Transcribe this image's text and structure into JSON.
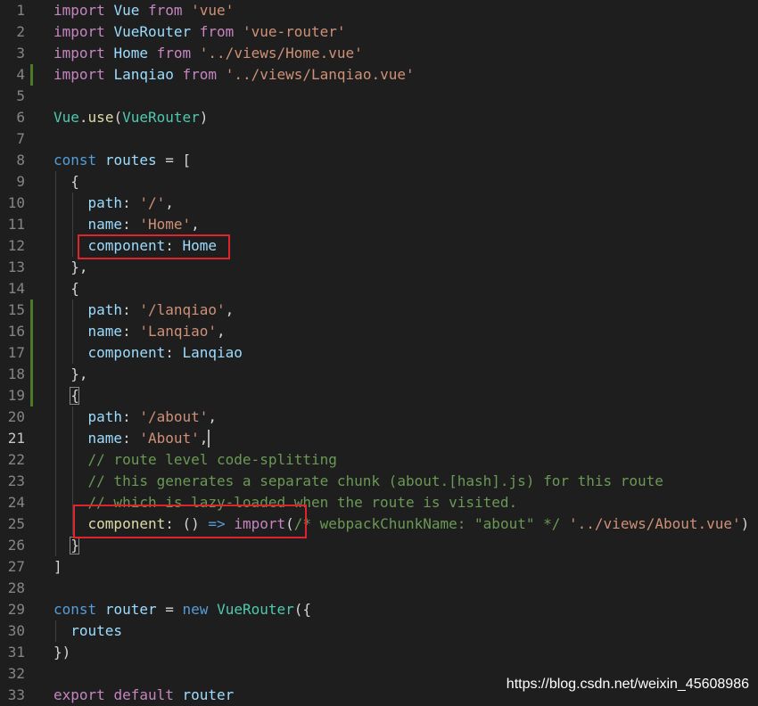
{
  "editor": {
    "active_line": 21,
    "colors": {
      "keyword": "#c586c0",
      "storage": "#569cd6",
      "variable": "#9cdcfe",
      "class": "#4ec9b0",
      "function": "#dcdcaa",
      "string": "#ce9178",
      "comment": "#6a9955",
      "punctuation": "#d4d4d4",
      "highlight_box": "#e0242d"
    },
    "lines": [
      {
        "n": "1",
        "tokens": [
          [
            "import",
            "keyword"
          ],
          [
            " "
          ],
          [
            "Vue",
            "variable"
          ],
          [
            " "
          ],
          [
            "from",
            "keyword"
          ],
          [
            " "
          ],
          [
            "'vue'",
            "string"
          ]
        ]
      },
      {
        "n": "2",
        "tokens": [
          [
            "import",
            "keyword"
          ],
          [
            " "
          ],
          [
            "VueRouter",
            "variable"
          ],
          [
            " "
          ],
          [
            "from",
            "keyword"
          ],
          [
            " "
          ],
          [
            "'vue-router'",
            "string"
          ]
        ]
      },
      {
        "n": "3",
        "tokens": [
          [
            "import",
            "keyword"
          ],
          [
            " "
          ],
          [
            "Home",
            "variable"
          ],
          [
            " "
          ],
          [
            "from",
            "keyword"
          ],
          [
            " "
          ],
          [
            "'../views/Home.vue'",
            "string"
          ]
        ]
      },
      {
        "n": "4",
        "tokens": [
          [
            "import",
            "keyword"
          ],
          [
            " "
          ],
          [
            "Lanqiao",
            "variable"
          ],
          [
            " "
          ],
          [
            "from",
            "keyword"
          ],
          [
            " "
          ],
          [
            "'../views/Lanqiao.vue'",
            "string"
          ]
        ]
      },
      {
        "n": "5",
        "tokens": []
      },
      {
        "n": "6",
        "tokens": [
          [
            "Vue",
            "class"
          ],
          [
            "."
          ],
          [
            "use",
            "function"
          ],
          [
            "("
          ],
          [
            "VueRouter",
            "class"
          ],
          [
            ")"
          ]
        ]
      },
      {
        "n": "7",
        "tokens": []
      },
      {
        "n": "8",
        "tokens": [
          [
            "const",
            "storage"
          ],
          [
            " "
          ],
          [
            "routes",
            "variable"
          ],
          [
            " = ["
          ]
        ]
      },
      {
        "n": "9",
        "tokens": [
          [
            "  {"
          ]
        ]
      },
      {
        "n": "10",
        "tokens": [
          [
            "    "
          ],
          [
            "path",
            "variable"
          ],
          [
            ": "
          ],
          [
            "'/'",
            "string"
          ],
          [
            ","
          ]
        ]
      },
      {
        "n": "11",
        "tokens": [
          [
            "    "
          ],
          [
            "name",
            "variable"
          ],
          [
            ": "
          ],
          [
            "'Home'",
            "string"
          ],
          [
            ","
          ]
        ]
      },
      {
        "n": "12",
        "tokens": [
          [
            "    "
          ],
          [
            "component",
            "variable"
          ],
          [
            ": "
          ],
          [
            "Home",
            "variable"
          ]
        ]
      },
      {
        "n": "13",
        "tokens": [
          [
            "  },"
          ]
        ]
      },
      {
        "n": "14",
        "tokens": [
          [
            "  {"
          ]
        ]
      },
      {
        "n": "15",
        "tokens": [
          [
            "    "
          ],
          [
            "path",
            "variable"
          ],
          [
            ": "
          ],
          [
            "'/lanqiao'",
            "string"
          ],
          [
            ","
          ]
        ]
      },
      {
        "n": "16",
        "tokens": [
          [
            "    "
          ],
          [
            "name",
            "variable"
          ],
          [
            ": "
          ],
          [
            "'Lanqiao'",
            "string"
          ],
          [
            ","
          ]
        ]
      },
      {
        "n": "17",
        "tokens": [
          [
            "    "
          ],
          [
            "component",
            "variable"
          ],
          [
            ": "
          ],
          [
            "Lanqiao",
            "variable"
          ]
        ]
      },
      {
        "n": "18",
        "tokens": [
          [
            "  },"
          ]
        ]
      },
      {
        "n": "19",
        "tokens": [
          [
            "  {"
          ]
        ]
      },
      {
        "n": "20",
        "tokens": [
          [
            "    "
          ],
          [
            "path",
            "variable"
          ],
          [
            ": "
          ],
          [
            "'/about'",
            "string"
          ],
          [
            ","
          ]
        ]
      },
      {
        "n": "21",
        "tokens": [
          [
            "    "
          ],
          [
            "name",
            "variable"
          ],
          [
            ": "
          ],
          [
            "'About'",
            "string"
          ],
          [
            ","
          ]
        ]
      },
      {
        "n": "22",
        "tokens": [
          [
            "    "
          ],
          [
            "// route level code-splitting",
            "comment"
          ]
        ]
      },
      {
        "n": "23",
        "tokens": [
          [
            "    "
          ],
          [
            "// this generates a separate chunk (about.[hash].js) for this route",
            "comment"
          ]
        ]
      },
      {
        "n": "24",
        "tokens": [
          [
            "    "
          ],
          [
            "// which is lazy-loaded when the route is visited.",
            "comment"
          ]
        ]
      },
      {
        "n": "25",
        "tokens": [
          [
            "    "
          ],
          [
            "component",
            "function"
          ],
          [
            ": () "
          ],
          [
            "=>",
            "storage"
          ],
          [
            " "
          ],
          [
            "import",
            "keyword"
          ],
          [
            "("
          ],
          [
            "/* webpackChunkName: \"about\" */",
            "comment"
          ],
          [
            " "
          ],
          [
            "'../views/About.vue'",
            "string"
          ],
          [
            ")"
          ]
        ]
      },
      {
        "n": "26",
        "tokens": [
          [
            "  }"
          ]
        ]
      },
      {
        "n": "27",
        "tokens": [
          [
            "]"
          ]
        ]
      },
      {
        "n": "28",
        "tokens": []
      },
      {
        "n": "29",
        "tokens": [
          [
            "const",
            "storage"
          ],
          [
            " "
          ],
          [
            "router",
            "variable"
          ],
          [
            " = "
          ],
          [
            "new",
            "storage"
          ],
          [
            " "
          ],
          [
            "VueRouter",
            "class"
          ],
          [
            "({"
          ]
        ]
      },
      {
        "n": "30",
        "tokens": [
          [
            "  "
          ],
          [
            "routes",
            "variable"
          ]
        ]
      },
      {
        "n": "31",
        "tokens": [
          [
            "})"
          ]
        ]
      },
      {
        "n": "32",
        "tokens": []
      },
      {
        "n": "33",
        "tokens": [
          [
            "export",
            "keyword"
          ],
          [
            " "
          ],
          [
            "default",
            "keyword"
          ],
          [
            " "
          ],
          [
            "router",
            "variable"
          ]
        ]
      }
    ]
  },
  "watermark": "https://blog.csdn.net/weixin_45608986"
}
